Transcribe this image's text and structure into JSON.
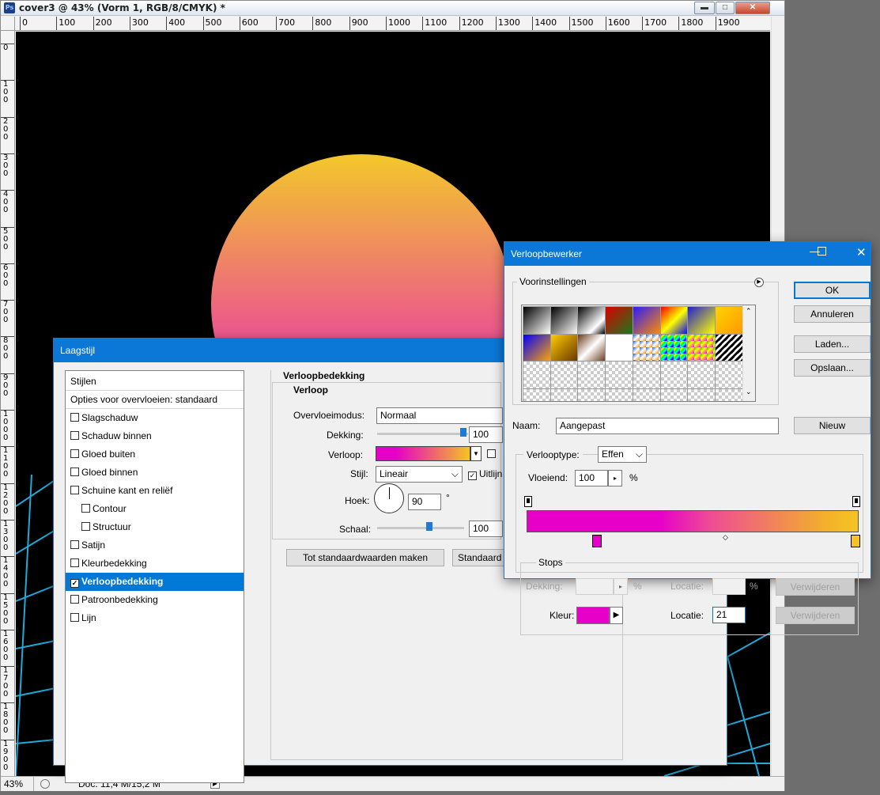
{
  "document": {
    "title": "cover3 @ 43% (Vorm 1, RGB/8/CMYK) *",
    "app_icon": "Ps",
    "ruler_h_labels": [
      "0",
      "100",
      "200",
      "300",
      "400",
      "500",
      "600",
      "700",
      "800",
      "900",
      "1000",
      "1100",
      "1200",
      "1300",
      "1400",
      "1500",
      "1600",
      "1700",
      "1800",
      "1900"
    ],
    "ruler_v_labels": [
      "0",
      "1\n0\n0",
      "2\n0\n0",
      "3\n0\n0",
      "4\n0\n0",
      "5\n0\n0",
      "6\n0\n0",
      "7\n0\n0",
      "8\n0\n0",
      "9\n0\n0",
      "1\n0\n0\n0",
      "1\n1\n0\n0",
      "1\n2\n0\n0",
      "1\n3\n0\n0",
      "1\n4\n0\n0",
      "1\n5\n0\n0",
      "1\n6\n0\n0",
      "1\n7\n0\n0",
      "1\n8\n0\n0",
      "1\n9\n0\n0"
    ],
    "zoom": "43%",
    "doc_info": "Doc: 11,4 M/15,2 M",
    "canvas_colors": {
      "background": "#000000",
      "sun_top": "#f2c32b",
      "sun_bottom": "#e62bbf",
      "grid": "#2ad0ff"
    }
  },
  "laagstijl": {
    "title": "Laagstijl",
    "list_header": "Stijlen",
    "list_subheader": "Opties voor overvloeien: standaard",
    "items": [
      {
        "label": "Slagschaduw",
        "checked": false
      },
      {
        "label": "Schaduw binnen",
        "checked": false
      },
      {
        "label": "Gloed buiten",
        "checked": false
      },
      {
        "label": "Gloed binnen",
        "checked": false
      },
      {
        "label": "Schuine kant en reliëf",
        "checked": false
      },
      {
        "label": "Contour",
        "checked": false
      },
      {
        "label": "Structuur",
        "checked": false
      },
      {
        "label": "Satijn",
        "checked": false
      },
      {
        "label": "Kleurbedekking",
        "checked": false
      },
      {
        "label": "Verloopbedekking",
        "checked": true
      },
      {
        "label": "Patroonbedekking",
        "checked": false
      },
      {
        "label": "Lijn",
        "checked": false
      }
    ],
    "section_title": "Verloopbedekking",
    "group_title": "Verloop",
    "blend_label": "Overvloeimodus:",
    "blend_value": "Normaal",
    "opacity_label": "Dekking:",
    "opacity_value": "100",
    "gradient_label": "Verloop:",
    "style_label": "Stijl:",
    "style_value": "Lineair",
    "align_label": "Uitlijn",
    "angle_label": "Hoek:",
    "angle_value": "90",
    "angle_unit": "°",
    "scale_label": "Schaal:",
    "scale_value": "100",
    "btn_default": "Tot standaardwaarden maken",
    "btn_reset": "Standaard"
  },
  "verloop": {
    "title": "Verloopbewerker",
    "presets_label": "Voorinstellingen",
    "ok": "OK",
    "cancel": "Annuleren",
    "load": "Laden...",
    "save": "Opslaan...",
    "name_label": "Naam:",
    "name_value": "Aangepast",
    "new": "Nieuw",
    "type_label": "Verlooptype:",
    "type_value": "Effen",
    "smooth_label": "Vloeiend:",
    "smooth_value": "100",
    "smooth_unit": "%",
    "stops_label": "Stops",
    "opacity_label": "Dekking:",
    "opacity_unit": "%",
    "location_label": "Locatie:",
    "location_unit": "%",
    "delete": "Verwijderen",
    "color_label": "Kleur:",
    "color_location_value": "21",
    "colors": {
      "stop_left": "#e600c8",
      "stop_right": "#f5c422",
      "color_swatch": "#e600c8"
    }
  }
}
